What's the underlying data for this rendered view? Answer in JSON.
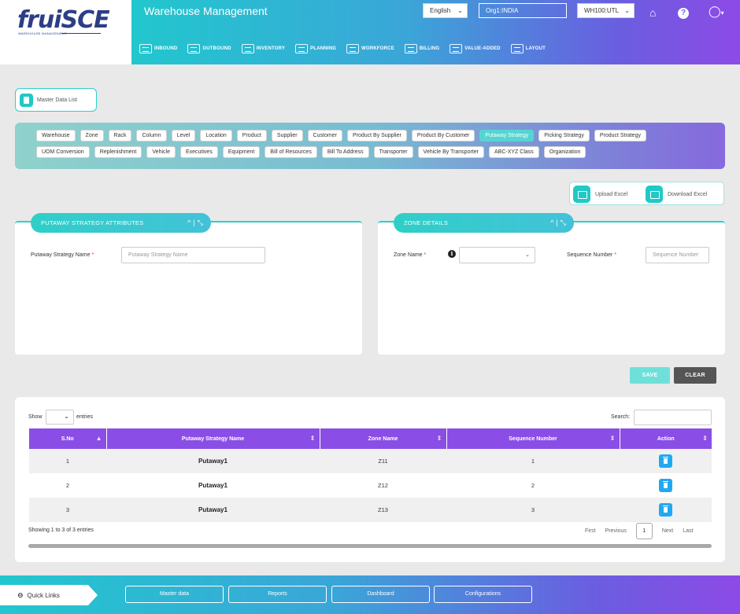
{
  "brand": {
    "logo": "fruiSCE",
    "tagline": "WAREHOUSE MANAGEMENT",
    "app_title": "Warehouse Management"
  },
  "header": {
    "language": "English",
    "org": "Org1:INDIA",
    "warehouse": "WH100:UTL"
  },
  "nav": [
    "INBOUND",
    "OUTBOUND",
    "INVENTORY",
    "PLANNING",
    "WORKFORCE",
    "BILLING",
    "VALUE-ADDED",
    "LAYOUT"
  ],
  "master_data_list": "Master Data List",
  "tags_row1": [
    "Warehouse",
    "Zone",
    "Rack",
    "Column",
    "Level",
    "Location",
    "Product",
    "Supplier",
    "Customer",
    "Product By Supplier",
    "Product By Customer",
    "Putaway Strategy",
    "Picking Strategy",
    "Product Strategy"
  ],
  "tags_row2": [
    "UOM Conversion",
    "Replenishment",
    "Vehicle",
    "Executives",
    "Equipment",
    "Bill of Resources",
    "Bill To Address",
    "Transporter",
    "Vehicle By Transporter",
    "ABC-XYZ Class",
    "Organization"
  ],
  "active_tag": "Putaway Strategy",
  "excel": {
    "upload": "Upload Excel",
    "download": "Download Excel"
  },
  "attributes_panel": {
    "title": "PUTAWAY STRATEGY ATTRIBUTES",
    "controls": "^ | ⤡",
    "name_label": "Putaway Strategy Name",
    "name_placeholder": "Putaway Strategy Name"
  },
  "zone_panel": {
    "title": "ZONE DETAILS",
    "controls": "^ | ⤡",
    "zone_label": "Zone Name",
    "seq_label": "Sequence Number",
    "seq_placeholder": "Sequence Number"
  },
  "actions": {
    "save": "SAVE",
    "clear": "CLEAR"
  },
  "table": {
    "show": "Show",
    "entries": "entries",
    "search": "Search:",
    "columns": [
      "S.No",
      "Putaway Strategy Name",
      "Zone Name",
      "Sequence Number",
      "Action"
    ],
    "rows": [
      {
        "sno": "1",
        "name": "Putaway1",
        "zone": "Z11",
        "seq": "1"
      },
      {
        "sno": "2",
        "name": "Putaway1",
        "zone": "Z12",
        "seq": "2"
      },
      {
        "sno": "3",
        "name": "Putaway1",
        "zone": "Z13",
        "seq": "3"
      }
    ],
    "showing": "Showing 1 to 3 of 3 entries",
    "pager": {
      "first": "First",
      "previous": "Previous",
      "current": "1",
      "next": "Next",
      "last": "Last"
    }
  },
  "footer": {
    "quick_links": "Quick Links",
    "buttons": [
      "Master data",
      "Reports",
      "Dashboard",
      "Configurations"
    ]
  }
}
